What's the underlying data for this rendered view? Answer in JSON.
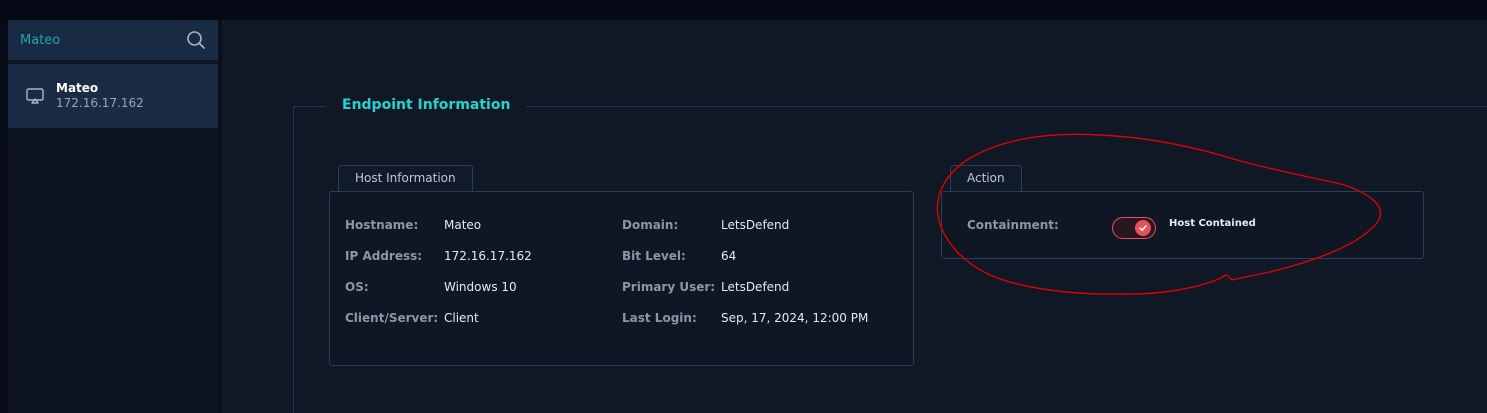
{
  "search": {
    "value": "Mateo",
    "icon": "search-icon"
  },
  "host_list": [
    {
      "name": "Mateo",
      "ip": "172.16.17.162",
      "icon": "monitor-icon"
    }
  ],
  "section": {
    "title": "Endpoint Information"
  },
  "host_info": {
    "tab_label": "Host Information",
    "left": [
      {
        "label": "Hostname:",
        "value": "Mateo"
      },
      {
        "label": "IP Address:",
        "value": "172.16.17.162"
      },
      {
        "label": "OS:",
        "value": "Windows 10"
      },
      {
        "label": "Client/Server:",
        "value": "Client"
      }
    ],
    "right": [
      {
        "label": "Domain:",
        "value": "LetsDefend"
      },
      {
        "label": "Bit Level:",
        "value": "64"
      },
      {
        "label": "Primary User:",
        "value": "LetsDefend"
      },
      {
        "label": "Last Login:",
        "value": "Sep, 17, 2024, 12:00 PM"
      }
    ]
  },
  "action": {
    "tab_label": "Action",
    "containment_label": "Containment:",
    "toggle_on": true,
    "status": "Host Contained"
  },
  "colors": {
    "accent": "#1ed6cf",
    "toggle": "#e8505b",
    "annotation": "#e00000"
  }
}
